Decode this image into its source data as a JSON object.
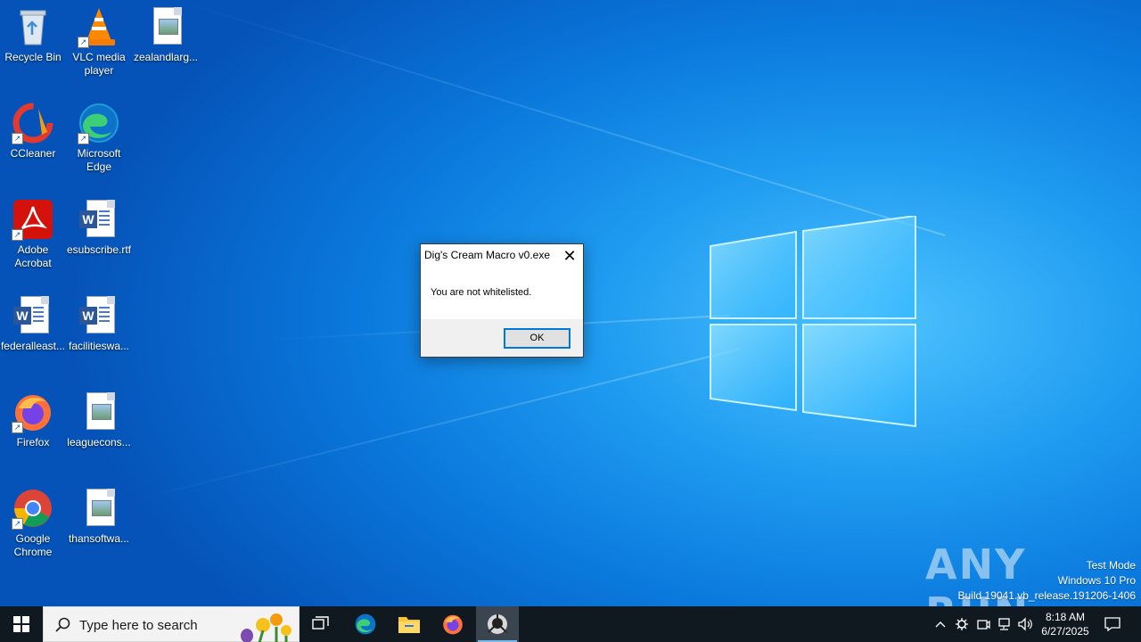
{
  "desktop": {
    "icons": [
      {
        "label": "Recycle Bin"
      },
      {
        "label": "VLC media player"
      },
      {
        "label": "zealandlarg..."
      },
      {
        "label": "CCleaner"
      },
      {
        "label": "Microsoft Edge"
      },
      {
        "label": "Adobe Acrobat"
      },
      {
        "label": "esubscribe.rtf"
      },
      {
        "label": "federalleast..."
      },
      {
        "label": "facilitieswa..."
      },
      {
        "label": "Firefox"
      },
      {
        "label": "leaguecons..."
      },
      {
        "label": "Google Chrome"
      },
      {
        "label": "thansoftwa..."
      }
    ]
  },
  "dialog": {
    "title": "Dig's Cream Macro v0.exe",
    "message": "You are not whitelisted.",
    "ok_label": "OK"
  },
  "watermark": {
    "brand": "ANY RUN",
    "line1": "Test Mode",
    "line2": "Windows 10 Pro",
    "line3": "Build 19041.vb_release.191206-1406"
  },
  "taskbar": {
    "search_placeholder": "Type here to search",
    "time": "8:18 AM",
    "date": "6/27/2025"
  },
  "colors": {
    "taskbar": "#101820",
    "accent": "#0078d7"
  }
}
